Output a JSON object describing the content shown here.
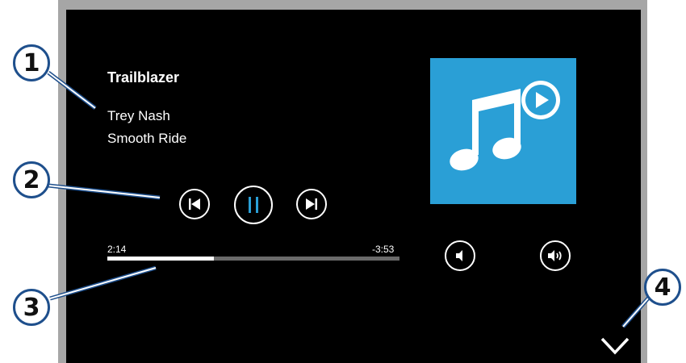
{
  "now_playing": {
    "title": "Trailblazer",
    "artist": "Trey Nash",
    "album": "Smooth Ride"
  },
  "progress": {
    "elapsed": "2:14",
    "remaining": "-3:53",
    "fraction": 0.365
  },
  "controls": {
    "previous_icon": "skip-previous-icon",
    "pause_icon": "pause-icon",
    "next_icon": "skip-next-icon",
    "volume_down_icon": "volume-down-icon",
    "volume_up_icon": "volume-up-icon",
    "expand_icon": "chevron-down-icon"
  },
  "album_art": {
    "icon": "music-note-play-icon",
    "color": "#2a9fd6"
  },
  "callouts": [
    "1",
    "2",
    "3",
    "4"
  ],
  "colors": {
    "callout_border": "#1e4f8c",
    "accent": "#2a9fd6",
    "background": "#000000"
  }
}
